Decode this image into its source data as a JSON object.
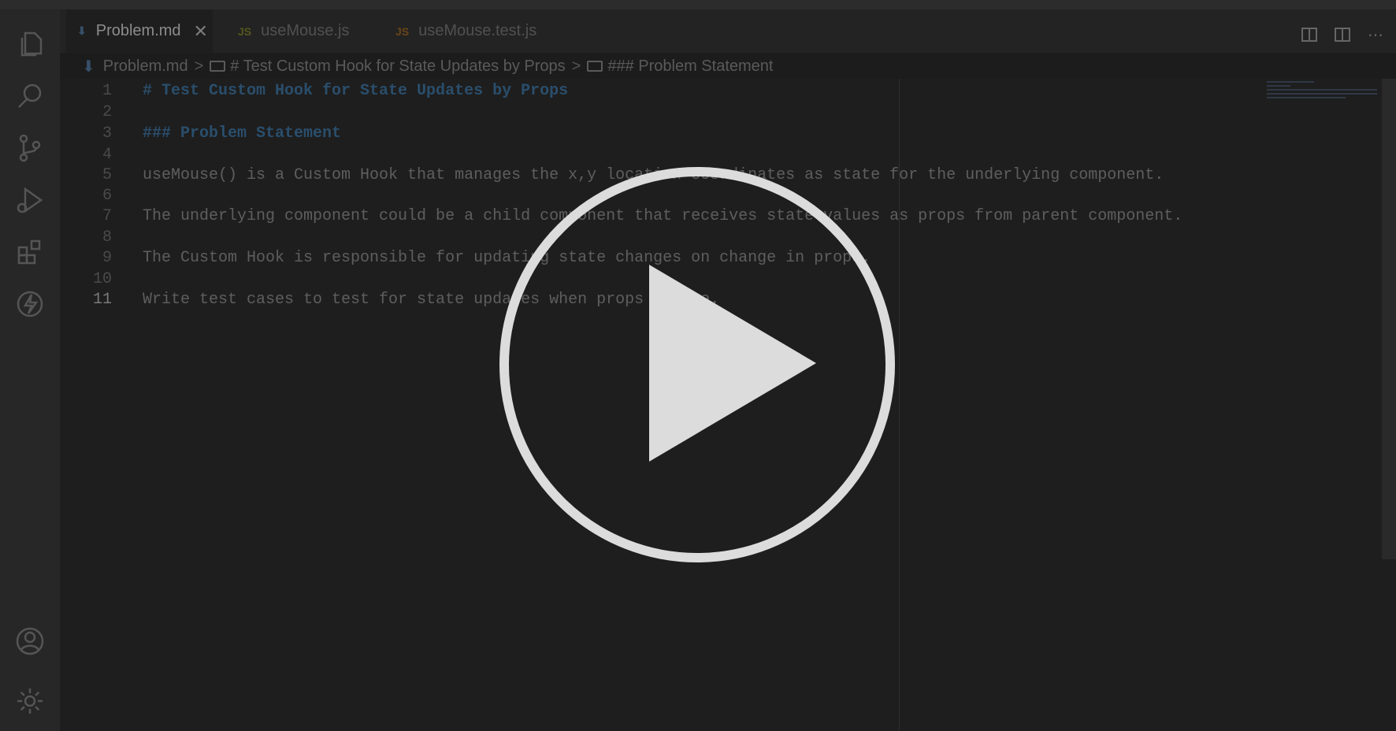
{
  "tabs": [
    {
      "icon": "markdown-icon",
      "label": "Problem.md",
      "active": true,
      "close": "✕"
    },
    {
      "icon": "js-icon",
      "icon_text": "JS",
      "label": "useMouse.js",
      "active": false
    },
    {
      "icon": "js-icon",
      "icon_text": "JS",
      "label": "useMouse.test.js",
      "active": false
    }
  ],
  "breadcrumb": {
    "file": "Problem.md",
    "heading1": "# Test Custom Hook for State Updates by Props",
    "heading2": "### Problem Statement",
    "separator": ">"
  },
  "editor": {
    "lines": [
      {
        "n": "1",
        "text": "# Test Custom Hook for State Updates by Props",
        "heading": true
      },
      {
        "n": "2",
        "text": ""
      },
      {
        "n": "3",
        "text": "### Problem Statement",
        "heading": true
      },
      {
        "n": "4",
        "text": ""
      },
      {
        "n": "5",
        "text": "useMouse() is a Custom Hook that manages the x,y location coordinates as state for the underlying component."
      },
      {
        "n": "6",
        "text": ""
      },
      {
        "n": "7",
        "text": "The underlying component could be a child component that receives state values as props from parent component."
      },
      {
        "n": "8",
        "text": ""
      },
      {
        "n": "9",
        "text": "The Custom Hook is responsible for updating state changes on change in props."
      },
      {
        "n": "10",
        "text": ""
      },
      {
        "n": "11",
        "text": "Write test cases to test for state updates when props change.",
        "current": true
      }
    ]
  },
  "activity_bar": {
    "top": [
      "files-icon",
      "search-icon",
      "source-control-icon",
      "run-debug-icon",
      "extensions-icon",
      "lightning-icon"
    ],
    "bottom": [
      "account-icon",
      "gear-icon"
    ]
  },
  "overlay": {
    "icon": "play-icon"
  },
  "colors": {
    "background": "#1e1e1e",
    "heading": "#2a4e6c",
    "overlay": "#dcdcdc"
  }
}
